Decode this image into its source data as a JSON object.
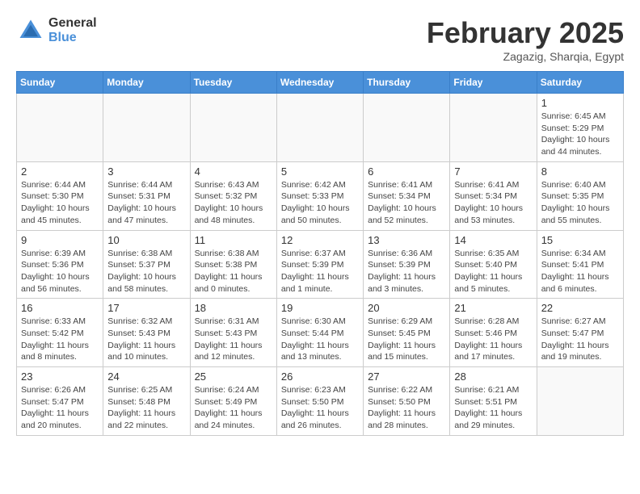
{
  "logo": {
    "general": "General",
    "blue": "Blue"
  },
  "title": {
    "month": "February 2025",
    "location": "Zagazig, Sharqia, Egypt"
  },
  "weekdays": [
    "Sunday",
    "Monday",
    "Tuesday",
    "Wednesday",
    "Thursday",
    "Friday",
    "Saturday"
  ],
  "weeks": [
    [
      {
        "day": "",
        "info": ""
      },
      {
        "day": "",
        "info": ""
      },
      {
        "day": "",
        "info": ""
      },
      {
        "day": "",
        "info": ""
      },
      {
        "day": "",
        "info": ""
      },
      {
        "day": "",
        "info": ""
      },
      {
        "day": "1",
        "info": "Sunrise: 6:45 AM\nSunset: 5:29 PM\nDaylight: 10 hours\nand 44 minutes."
      }
    ],
    [
      {
        "day": "2",
        "info": "Sunrise: 6:44 AM\nSunset: 5:30 PM\nDaylight: 10 hours\nand 45 minutes."
      },
      {
        "day": "3",
        "info": "Sunrise: 6:44 AM\nSunset: 5:31 PM\nDaylight: 10 hours\nand 47 minutes."
      },
      {
        "day": "4",
        "info": "Sunrise: 6:43 AM\nSunset: 5:32 PM\nDaylight: 10 hours\nand 48 minutes."
      },
      {
        "day": "5",
        "info": "Sunrise: 6:42 AM\nSunset: 5:33 PM\nDaylight: 10 hours\nand 50 minutes."
      },
      {
        "day": "6",
        "info": "Sunrise: 6:41 AM\nSunset: 5:34 PM\nDaylight: 10 hours\nand 52 minutes."
      },
      {
        "day": "7",
        "info": "Sunrise: 6:41 AM\nSunset: 5:34 PM\nDaylight: 10 hours\nand 53 minutes."
      },
      {
        "day": "8",
        "info": "Sunrise: 6:40 AM\nSunset: 5:35 PM\nDaylight: 10 hours\nand 55 minutes."
      }
    ],
    [
      {
        "day": "9",
        "info": "Sunrise: 6:39 AM\nSunset: 5:36 PM\nDaylight: 10 hours\nand 56 minutes."
      },
      {
        "day": "10",
        "info": "Sunrise: 6:38 AM\nSunset: 5:37 PM\nDaylight: 10 hours\nand 58 minutes."
      },
      {
        "day": "11",
        "info": "Sunrise: 6:38 AM\nSunset: 5:38 PM\nDaylight: 11 hours\nand 0 minutes."
      },
      {
        "day": "12",
        "info": "Sunrise: 6:37 AM\nSunset: 5:39 PM\nDaylight: 11 hours\nand 1 minute."
      },
      {
        "day": "13",
        "info": "Sunrise: 6:36 AM\nSunset: 5:39 PM\nDaylight: 11 hours\nand 3 minutes."
      },
      {
        "day": "14",
        "info": "Sunrise: 6:35 AM\nSunset: 5:40 PM\nDaylight: 11 hours\nand 5 minutes."
      },
      {
        "day": "15",
        "info": "Sunrise: 6:34 AM\nSunset: 5:41 PM\nDaylight: 11 hours\nand 6 minutes."
      }
    ],
    [
      {
        "day": "16",
        "info": "Sunrise: 6:33 AM\nSunset: 5:42 PM\nDaylight: 11 hours\nand 8 minutes."
      },
      {
        "day": "17",
        "info": "Sunrise: 6:32 AM\nSunset: 5:43 PM\nDaylight: 11 hours\nand 10 minutes."
      },
      {
        "day": "18",
        "info": "Sunrise: 6:31 AM\nSunset: 5:43 PM\nDaylight: 11 hours\nand 12 minutes."
      },
      {
        "day": "19",
        "info": "Sunrise: 6:30 AM\nSunset: 5:44 PM\nDaylight: 11 hours\nand 13 minutes."
      },
      {
        "day": "20",
        "info": "Sunrise: 6:29 AM\nSunset: 5:45 PM\nDaylight: 11 hours\nand 15 minutes."
      },
      {
        "day": "21",
        "info": "Sunrise: 6:28 AM\nSunset: 5:46 PM\nDaylight: 11 hours\nand 17 minutes."
      },
      {
        "day": "22",
        "info": "Sunrise: 6:27 AM\nSunset: 5:47 PM\nDaylight: 11 hours\nand 19 minutes."
      }
    ],
    [
      {
        "day": "23",
        "info": "Sunrise: 6:26 AM\nSunset: 5:47 PM\nDaylight: 11 hours\nand 20 minutes."
      },
      {
        "day": "24",
        "info": "Sunrise: 6:25 AM\nSunset: 5:48 PM\nDaylight: 11 hours\nand 22 minutes."
      },
      {
        "day": "25",
        "info": "Sunrise: 6:24 AM\nSunset: 5:49 PM\nDaylight: 11 hours\nand 24 minutes."
      },
      {
        "day": "26",
        "info": "Sunrise: 6:23 AM\nSunset: 5:50 PM\nDaylight: 11 hours\nand 26 minutes."
      },
      {
        "day": "27",
        "info": "Sunrise: 6:22 AM\nSunset: 5:50 PM\nDaylight: 11 hours\nand 28 minutes."
      },
      {
        "day": "28",
        "info": "Sunrise: 6:21 AM\nSunset: 5:51 PM\nDaylight: 11 hours\nand 29 minutes."
      },
      {
        "day": "",
        "info": ""
      }
    ]
  ]
}
